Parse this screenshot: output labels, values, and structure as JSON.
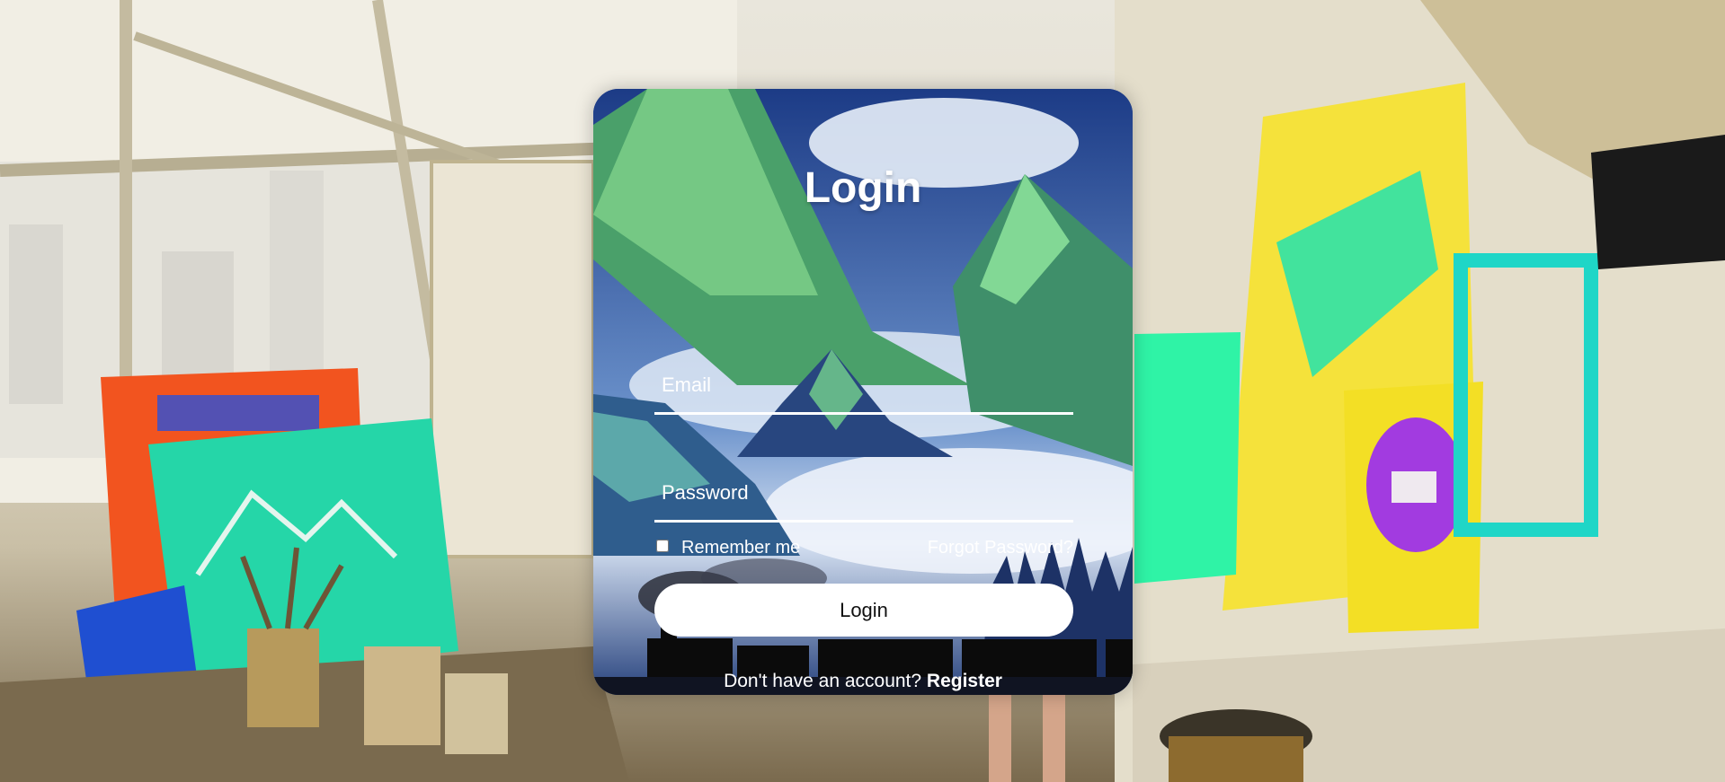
{
  "login_form": {
    "title": "Login",
    "email_placeholder": "Email",
    "password_placeholder": "Password",
    "remember_label": "Remember me",
    "forgot_password_link": "Forgot Password?",
    "login_button_label": "Login",
    "register_prompt": "Don't have an account?",
    "register_link": "Register"
  },
  "colors": {
    "card_top": "#1e3f8a",
    "mountain_green": "#5fbf7d",
    "text": "#ffffff",
    "button_bg": "#ffffff"
  }
}
